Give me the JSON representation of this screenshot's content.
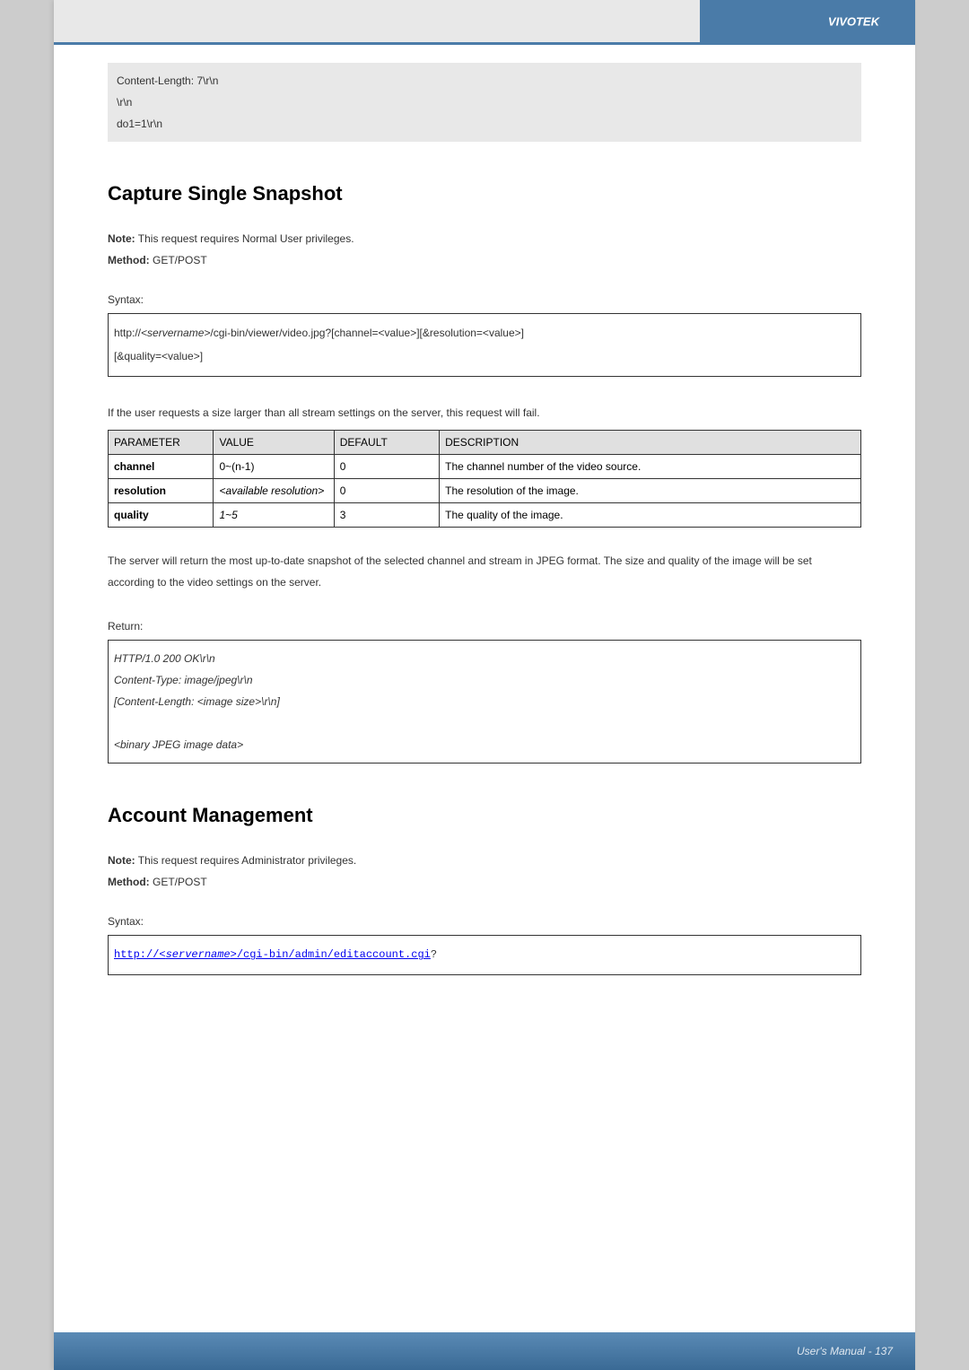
{
  "brand": "VIVOTEK",
  "code_block": {
    "line1": "Content-Length: 7\\r\\n",
    "line2": "\\r\\n",
    "line3": "do1=1\\r\\n"
  },
  "section1": {
    "heading": "Capture Single Snapshot",
    "note_label": "Note:",
    "note_text": " This request requires Normal User privileges.",
    "method_label": "Method:",
    "method_text": " GET/POST",
    "syntax_label": "Syntax:",
    "syntax_line1_prefix": "http://",
    "syntax_line1_server": "<servername>",
    "syntax_line1_rest": "/cgi-bin/viewer/video.jpg?[channel=<value>][&resolution=<value>]",
    "syntax_line2": "[&quality=<value>]",
    "intro": "If the user requests a size larger than all stream settings on the server, this request will fail.",
    "table": {
      "headers": {
        "parameter": "PARAMETER",
        "value": "VALUE",
        "default": "DEFAULT",
        "description": "DESCRIPTION"
      },
      "rows": [
        {
          "parameter": "channel",
          "value": "0~(n-1)",
          "default": "0",
          "description": "The channel number of the video source."
        },
        {
          "parameter": "resolution",
          "value": "<available resolution>",
          "default": "0",
          "description": "The resolution of the image."
        },
        {
          "parameter": "quality",
          "value": "1~5",
          "default": "3",
          "description": "The quality of the image."
        }
      ]
    },
    "body_text": "The server will return the most up-to-date snapshot of the selected channel and stream in JPEG format. The size and quality of the image will be set according to the video settings on the server.",
    "return_label": "Return:",
    "return_box": {
      "line1": "HTTP/1.0 200 OK\\r\\n",
      "line2": "Content-Type: image/jpeg\\r\\n",
      "line3": "[Content-Length: <image size>\\r\\n]",
      "line4": "<binary JPEG image data>"
    }
  },
  "section2": {
    "heading": "Account Management",
    "note_label": "Note:",
    "note_text": " This request requires Administrator privileges.",
    "method_label": "Method:",
    "method_text": " GET/POST",
    "syntax_label": "Syntax:",
    "syntax_link_prefix": "http://<",
    "syntax_link_server": "servername",
    "syntax_link_rest": ">/cgi-bin/admin/editaccount.cgi",
    "syntax_link_qmark": "?"
  },
  "footer": {
    "text": "User's Manual - 137"
  }
}
